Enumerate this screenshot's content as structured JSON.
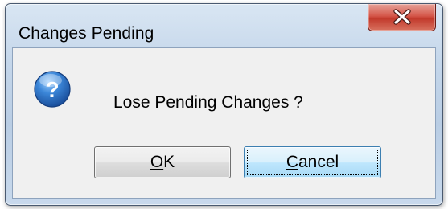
{
  "window": {
    "title": "Changes Pending"
  },
  "titlebar": {
    "close_icon": "close-x-icon",
    "close_color": "#c7483a"
  },
  "dialog": {
    "icon": "question-icon",
    "icon_color": "#2f74c4",
    "message": "Lose Pending Changes ?"
  },
  "buttons": {
    "ok": {
      "mnemonic": "O",
      "rest": "K"
    },
    "cancel": {
      "mnemonic": "C",
      "rest": "ancel",
      "focused": true
    }
  }
}
